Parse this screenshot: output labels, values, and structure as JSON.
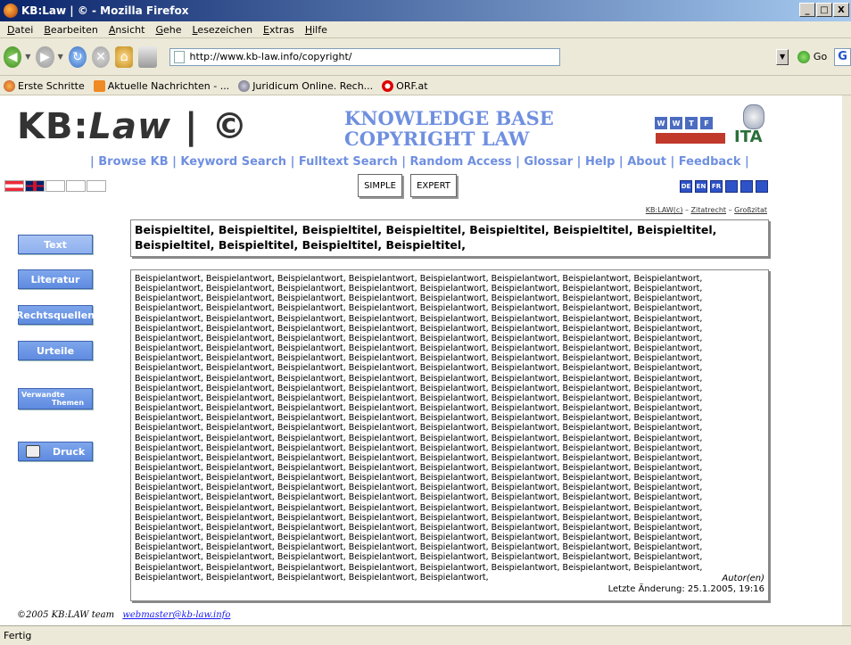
{
  "window": {
    "title": "KB:Law | © - Mozilla Firefox"
  },
  "menu": {
    "items": [
      "Datei",
      "Bearbeiten",
      "Ansicht",
      "Gehe",
      "Lesezeichen",
      "Extras",
      "Hilfe"
    ]
  },
  "toolbar": {
    "url": "http://www.kb-law.info/copyright/",
    "go_label": "Go"
  },
  "bookmarks": [
    "Erste Schritte",
    "Aktuelle Nachrichten - ...",
    "Juridicum Online. Rech...",
    "ORF.at"
  ],
  "site": {
    "logo_pre": "KB:",
    "logo_em": "Law",
    "logo_post": " | ©",
    "kb_title_1": "KNOWLEDGE BASE",
    "kb_title_2": "COPYRIGHT LAW",
    "sponsor_letters": [
      "W",
      "W",
      "T",
      "F"
    ],
    "ita_label": "ITA",
    "nav": "| Browse KB | Keyword Search | Fulltext Search | Random Access | Glossar | Help | About | Feedback |",
    "mode_simple": "SIMPLE",
    "mode_expert": "EXPERT",
    "langs": [
      "DE",
      "EN",
      "FR",
      "",
      "",
      ""
    ],
    "cite_1": "KB:LAW(c)",
    "cite_sep1": " – ",
    "cite_2": "Zitatrecht",
    "cite_sep2": " – ",
    "cite_3": "Großzitat"
  },
  "sidebar": {
    "text": "Text",
    "literatur": "Literatur",
    "rechtsquellen": "Rechtsquellen",
    "urteile": "Urteile",
    "verwandte_1": "Verwandte",
    "verwandte_2": "Themen",
    "druck": "Druck"
  },
  "article": {
    "title": "Beispieltitel, Beispieltitel, Beispieltitel, Beispieltitel, Beispieltitel, Beispieltitel, Beispieltitel, Beispieltitel, Beispieltitel, Beispieltitel, Beispieltitel,",
    "answer_word": "Beispielantwort,",
    "answer_count": 245,
    "autor": "Autor(en)",
    "last_change": "Letzte Änderung: 25.1.2005, 19:16"
  },
  "footer": {
    "copyright": "©2005 KB:LAW team",
    "email": "webmaster@kb-law.info"
  },
  "status": {
    "text": "Fertig"
  }
}
